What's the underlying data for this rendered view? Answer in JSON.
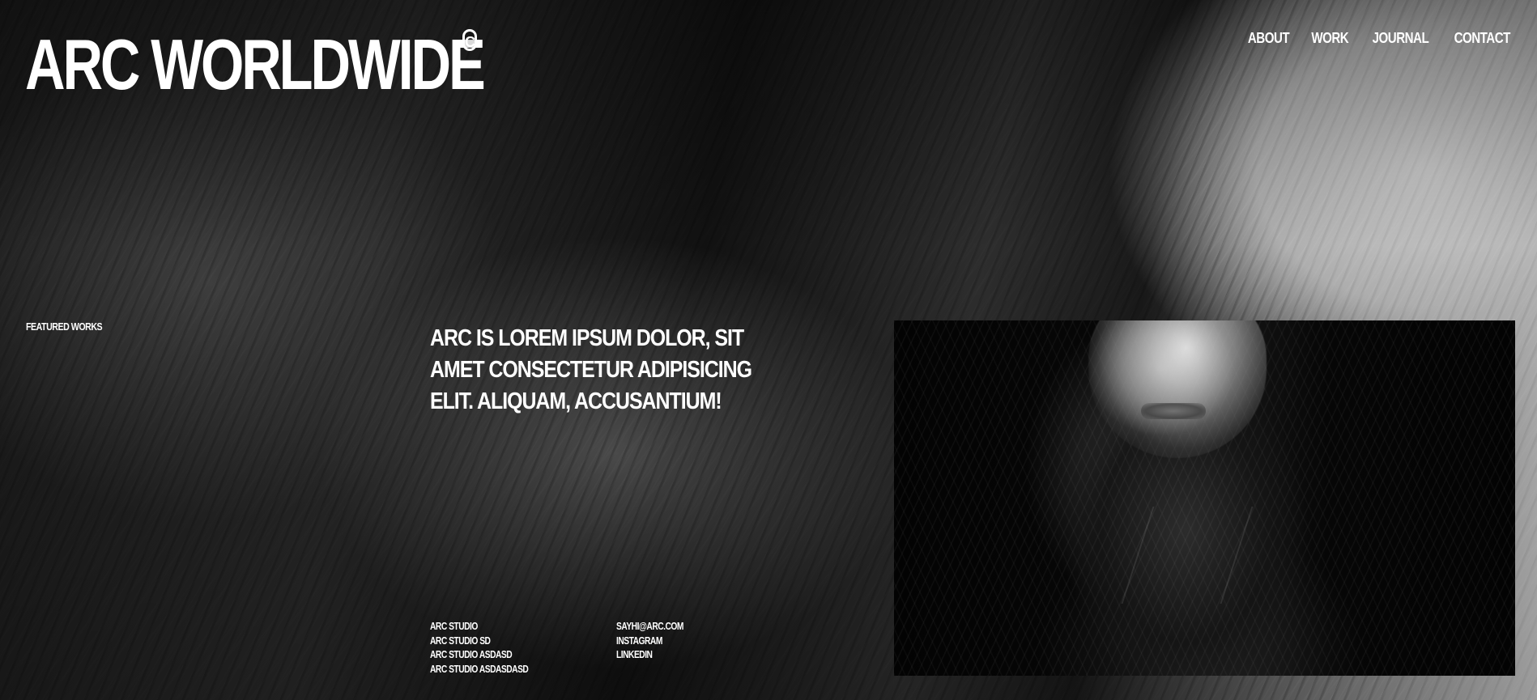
{
  "brand": {
    "logo_text": "ARC WORLDWIDE",
    "logo_mark": "C"
  },
  "nav": {
    "items": [
      {
        "label": "ABOUT"
      },
      {
        "label": "WORK"
      },
      {
        "label": "JOURNAL"
      },
      {
        "label": "CONTACT"
      }
    ]
  },
  "section": {
    "featured_label": "FEATURED WORKS"
  },
  "hero": {
    "headline": "ARC IS LOREM IPSUM DOLOR, SIT AMET CONSECTETUR ADIPISICING ELIT. ALIQUAM, ACCUSANTIUM!"
  },
  "footer": {
    "studios": [
      "ARC STUDIO",
      "ARC STUDIO SD",
      "ARC STUDIO ASDASD",
      "ARC STUDIO ASDASDASD"
    ],
    "contact": [
      "SAYHI@ARC.COM",
      "INSTAGRAM",
      "LINKEDIN"
    ]
  }
}
